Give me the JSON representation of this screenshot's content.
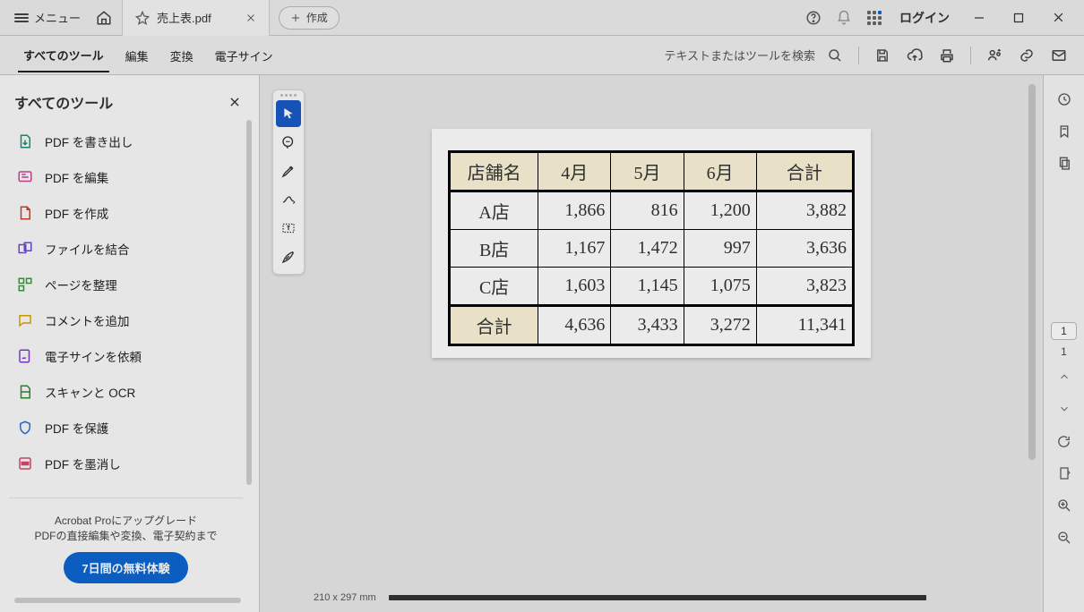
{
  "titlebar": {
    "menu_label": "メニュー",
    "tab_filename": "売上表.pdf",
    "new_label": "作成",
    "login_label": "ログイン"
  },
  "toolbar2": {
    "tabs": {
      "all_tools": "すべてのツール",
      "edit": "編集",
      "convert": "変換",
      "esign": "電子サイン"
    },
    "search_placeholder": "テキストまたはツールを検索"
  },
  "left_panel": {
    "heading": "すべてのツール",
    "items": {
      "export": "PDF を書き出し",
      "edit": "PDF を編集",
      "create": "PDF を作成",
      "combine": "ファイルを結合",
      "organize": "ページを整理",
      "comment": "コメントを追加",
      "request_sign": "電子サインを依頼",
      "scan_ocr": "スキャンと OCR",
      "protect": "PDF を保護",
      "redact": "PDF を墨消し"
    },
    "upgrade_l1": "Acrobat Proにアップグレード",
    "upgrade_l2": "PDFの直接編集や変換、電子契約まで",
    "trial_btn": "7日間の無料体験"
  },
  "doc": {
    "page_size": "210 x 297 mm"
  },
  "nav": {
    "page_input": "1",
    "page_total": "1"
  },
  "chart_data": {
    "type": "table",
    "title": "売上表",
    "headers": [
      "店舗名",
      "4月",
      "5月",
      "6月",
      "合計"
    ],
    "rows": [
      {
        "store": "A店",
        "apr": "1,866",
        "may": "816",
        "jun": "1,200",
        "total": "3,882"
      },
      {
        "store": "B店",
        "apr": "1,167",
        "may": "1,472",
        "jun": "997",
        "total": "3,636"
      },
      {
        "store": "C店",
        "apr": "1,603",
        "may": "1,145",
        "jun": "1,075",
        "total": "3,823"
      }
    ],
    "footer": {
      "label": "合計",
      "apr": "4,636",
      "may": "3,433",
      "jun": "3,272",
      "total": "11,341"
    }
  }
}
